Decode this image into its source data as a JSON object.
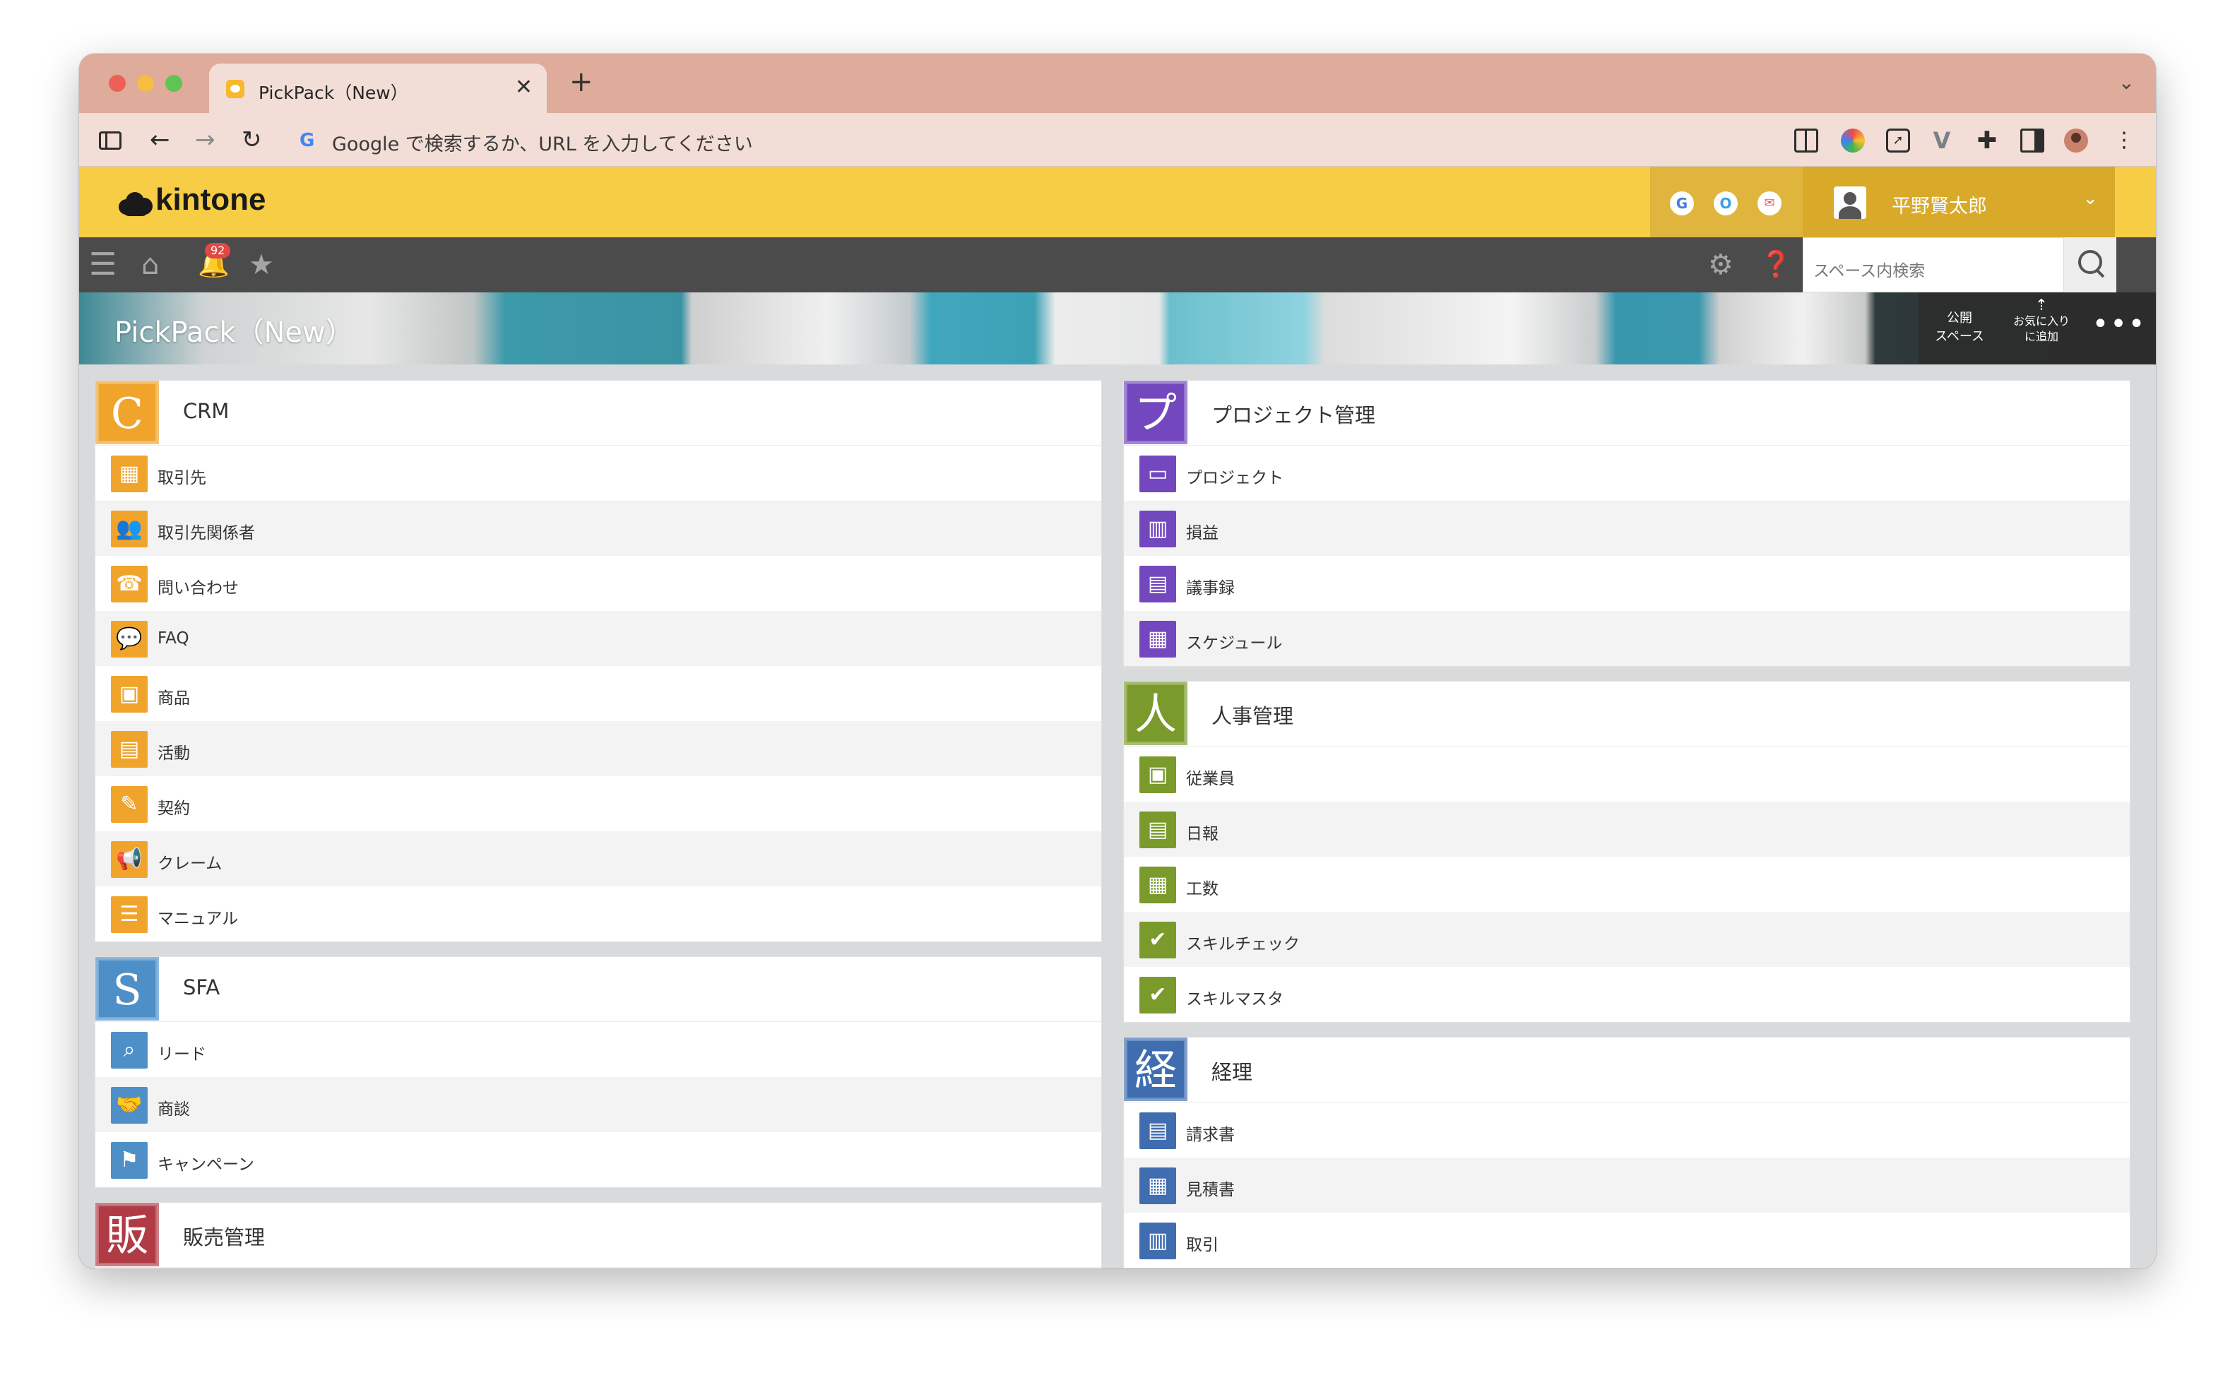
{
  "browser": {
    "tab_title": "PickPack（New）",
    "tab_close": "✕",
    "new_tab": "+",
    "tab_menu": "⌄",
    "address_placeholder": "Google で検索するか、URL を入力してください",
    "google_g": "G",
    "back": "←",
    "forward": "→",
    "reload": "↻"
  },
  "kintone": {
    "logo_text": "kintone",
    "header_apps": [
      "G",
      "O",
      "✉"
    ],
    "user_name": "平野賢太郎",
    "notification_count": "92",
    "search_placeholder": "スペース内検索"
  },
  "space": {
    "title": "PickPack（New）",
    "public_label": "公開\nスペース",
    "favorite_label": "お気に入り\nに追加",
    "more_label": "•••"
  },
  "colors": {
    "header_yellow": "#f7cd45",
    "crm": "#f0a42c",
    "sfa": "#4e8fc8",
    "sales": "#b13b45",
    "project": "#7348bf",
    "hr": "#7a9a2c",
    "accounting": "#3f6db0"
  },
  "left_groups": [
    {
      "icon_char": "C",
      "name": "CRM",
      "color": "#f0a42c",
      "apps": [
        {
          "label": "取引先",
          "icon": "building-icon",
          "glyph": "▦"
        },
        {
          "label": "取引先関係者",
          "icon": "people-icon",
          "glyph": "👥"
        },
        {
          "label": "問い合わせ",
          "icon": "headset-icon",
          "glyph": "☎"
        },
        {
          "label": "FAQ",
          "icon": "chat-bubbles-icon",
          "glyph": "💬"
        },
        {
          "label": "商品",
          "icon": "box-icon",
          "glyph": "▣"
        },
        {
          "label": "活動",
          "icon": "briefcase-icon",
          "glyph": "▤"
        },
        {
          "label": "契約",
          "icon": "contract-pen-icon",
          "glyph": "✎"
        },
        {
          "label": "クレーム",
          "icon": "megaphone-icon",
          "glyph": "📢"
        },
        {
          "label": "マニュアル",
          "icon": "books-icon",
          "glyph": "☰"
        }
      ]
    },
    {
      "icon_char": "S",
      "name": "SFA",
      "color": "#4e8fc8",
      "apps": [
        {
          "label": "リード",
          "icon": "magnifier-person-icon",
          "glyph": "⌕"
        },
        {
          "label": "商談",
          "icon": "handshake-icon",
          "glyph": "🤝"
        },
        {
          "label": "キャンペーン",
          "icon": "flag-icon",
          "glyph": "⚑"
        }
      ]
    },
    {
      "icon_char": "販",
      "name": "販売管理",
      "color": "#b13b45",
      "apps": []
    }
  ],
  "right_groups": [
    {
      "icon_char": "プ",
      "name": "プロジェクト管理",
      "color": "#7348bf",
      "apps": [
        {
          "label": "プロジェクト",
          "icon": "folder-icon",
          "glyph": "▭"
        },
        {
          "label": "損益",
          "icon": "bar-chart-icon",
          "glyph": "▥"
        },
        {
          "label": "議事録",
          "icon": "document-icon",
          "glyph": "▤"
        },
        {
          "label": "スケジュール",
          "icon": "calendar-icon",
          "glyph": "▦"
        }
      ]
    },
    {
      "icon_char": "人",
      "name": "人事管理",
      "color": "#7a9a2c",
      "apps": [
        {
          "label": "従業員",
          "icon": "id-card-icon",
          "glyph": "▣"
        },
        {
          "label": "日報",
          "icon": "notepad-icon",
          "glyph": "▤"
        },
        {
          "label": "工数",
          "icon": "calendar-clock-icon",
          "glyph": "▦"
        },
        {
          "label": "スキルチェック",
          "icon": "person-check-icon",
          "glyph": "✔"
        },
        {
          "label": "スキルマスタ",
          "icon": "person-badge-icon",
          "glyph": "✔"
        }
      ]
    },
    {
      "icon_char": "経",
      "name": "経理",
      "color": "#3f6db0",
      "apps": [
        {
          "label": "請求書",
          "icon": "invoice-icon",
          "glyph": "▤"
        },
        {
          "label": "見積書",
          "icon": "calculator-icon",
          "glyph": "▦"
        },
        {
          "label": "取引",
          "icon": "table-icon",
          "glyph": "▥"
        }
      ]
    }
  ]
}
